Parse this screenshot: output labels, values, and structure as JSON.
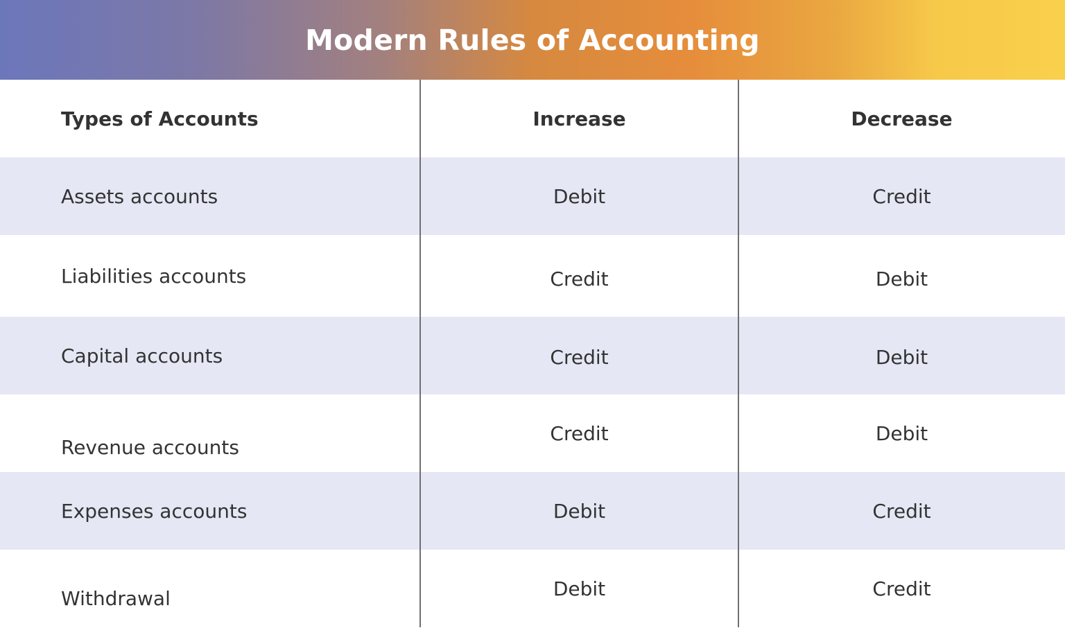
{
  "title": "Modern Rules of Accounting",
  "colors": {
    "gradient_start": "#6c77bb",
    "gradient_mid": "#e68d3c",
    "gradient_end": "#f9d04b",
    "row_shade": "#e5e7f4",
    "text": "#333333"
  },
  "table": {
    "headers": {
      "type": "Types of Accounts",
      "increase": "Increase",
      "decrease": "Decrease"
    },
    "rows": [
      {
        "type": "Assets accounts",
        "increase": "Debit",
        "decrease": "Credit"
      },
      {
        "type": "Liabilities accounts",
        "increase": "Credit",
        "decrease": "Debit"
      },
      {
        "type": "Capital accounts",
        "increase": "Credit",
        "decrease": "Debit"
      },
      {
        "type": "Revenue accounts",
        "increase": "Credit",
        "decrease": "Debit"
      },
      {
        "type": "Expenses accounts",
        "increase": "Debit",
        "decrease": "Credit"
      },
      {
        "type": "Withdrawal",
        "increase": "Debit",
        "decrease": "Credit"
      }
    ]
  }
}
